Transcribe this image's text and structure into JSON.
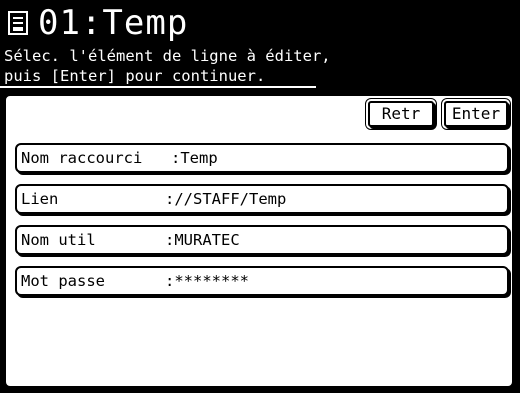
{
  "header": {
    "title": "01:Temp",
    "instruction_line1": "Sélec. l'élément de ligne à éditer,",
    "instruction_line2": "puis [Enter] pour continuer."
  },
  "toolbar": {
    "retr_label": "Retr",
    "enter_label": "Enter"
  },
  "fields": [
    {
      "label": "Nom raccourci",
      "value": ":Temp"
    },
    {
      "label": "Lien",
      "value": "://STAFF/Temp"
    },
    {
      "label": "Nom util",
      "value": ":MURATEC"
    },
    {
      "label": "Mot passe",
      "value": ":********"
    }
  ]
}
